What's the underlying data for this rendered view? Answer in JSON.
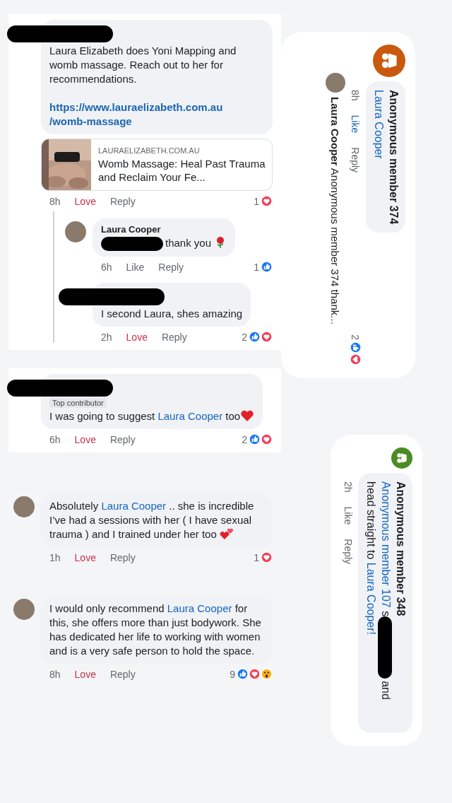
{
  "left_panels": [
    {
      "comments": [
        {
          "name_redacted": true,
          "segments": [
            {
              "kind": "plain",
              "text": "Laura Elizabeth does Yoni Mapping and womb massage. Reach out to her for recommendations."
            }
          ],
          "link_lines": [
            "https://www.lauraelizabeth.com.au",
            "/womb-massage"
          ],
          "preview": {
            "domain": "LAURAELIZABETH.COM.AU",
            "title": "Womb Massage: Heal Past Trauma and Reclaim Your Fe..."
          },
          "time": "8h",
          "action": {
            "label": "Love",
            "kind": "love",
            "reacted": true
          },
          "reply_label": "Reply",
          "reaction_count": "1",
          "reaction_icons": [
            {
              "kind": "love"
            }
          ],
          "replies": [
            {
              "author": "Laura Cooper",
              "segments": [
                {
                  "kind": "redaction"
                },
                {
                  "kind": "plain",
                  "text": "thank you"
                },
                {
                  "kind": "rose"
                }
              ],
              "time": "6h",
              "action": {
                "label": "Like",
                "reacted": false
              },
              "reply_label": "Reply",
              "reaction_count": "1",
              "reaction_icons": [
                {
                  "kind": "like"
                }
              ]
            },
            {
              "name_redacted": true,
              "segments": [
                {
                  "kind": "plain",
                  "text": "I second Laura, shes amazing"
                }
              ],
              "time": "2h",
              "action": {
                "label": "Love",
                "kind": "love",
                "reacted": true
              },
              "reply_label": "Reply",
              "reaction_count": "2",
              "reaction_icons": [
                {
                  "kind": "like"
                },
                {
                  "kind": "love"
                }
              ]
            }
          ]
        }
      ]
    },
    {
      "comments": [
        {
          "name_redacted": true,
          "badge": "Top contributor",
          "segments": [
            {
              "kind": "plain",
              "text": "I was going to suggest "
            },
            {
              "kind": "mention",
              "text": "Laura Cooper"
            },
            {
              "kind": "plain",
              "text": " too"
            },
            {
              "kind": "heart"
            }
          ],
          "time": "6h",
          "action": {
            "label": "Love",
            "kind": "love",
            "reacted": true
          },
          "reply_label": "Reply",
          "reaction_count": "2",
          "reaction_icons": [
            {
              "kind": "like"
            },
            {
              "kind": "love"
            }
          ]
        }
      ]
    },
    {
      "comments": [
        {
          "segments": [
            {
              "kind": "plain",
              "text": "Absolutely "
            },
            {
              "kind": "mention",
              "text": "Laura Cooper"
            },
            {
              "kind": "plain",
              "text": " .. she is incredible I’ve had a sessions with her  ( I have sexual trauma ) and I trained under her too"
            },
            {
              "kind": "hearts"
            }
          ],
          "time": "1h",
          "action": {
            "label": "Love",
            "kind": "love",
            "reacted": true
          },
          "reply_label": "Reply",
          "reaction_count": "1",
          "reaction_icons": [
            {
              "kind": "love"
            }
          ]
        },
        {
          "segments": [
            {
              "kind": "plain",
              "text": "I would only recommend "
            },
            {
              "kind": "mention",
              "text": "Laura Cooper"
            },
            {
              "kind": "plain",
              "text": " for this, she offers more than just bodywork. She has dedicated her life to working with women and is a very safe person to hold the space."
            }
          ],
          "time": "8h",
          "action": {
            "label": "Love",
            "kind": "love",
            "reacted": true
          },
          "reply_label": "Reply",
          "reaction_count": "9",
          "reaction_icons": [
            {
              "kind": "like"
            },
            {
              "kind": "love"
            },
            {
              "kind": "wow"
            }
          ]
        }
      ]
    }
  ],
  "rotated_cards": [
    {
      "color": "#c8590f",
      "author": "Anonymous member 374",
      "segments": [
        {
          "kind": "mention",
          "text": "Laura Cooper"
        }
      ],
      "time": "8h",
      "action": {
        "label": "Like",
        "reacted": true
      },
      "reply_label": "Reply",
      "reaction_count": "2",
      "reaction_icons": [
        {
          "kind": "like"
        },
        {
          "kind": "love"
        }
      ],
      "reply_preview": {
        "author": "Laura Cooper",
        "text": "Anonymous member 374 thank..."
      }
    },
    {
      "color": "#4a8c23",
      "author": "Anonymous member 348",
      "segments": [
        {
          "kind": "mention",
          "text": "Anonymous member 107"
        },
        {
          "kind": "plain",
          "text": " s"
        },
        {
          "kind": "redaction"
        },
        {
          "kind": "plain",
          "text": "and head straight to "
        },
        {
          "kind": "mention",
          "text": "Laura Cooper!"
        }
      ],
      "time": "2h",
      "action": {
        "label": "Like",
        "reacted": false
      },
      "reply_label": "Reply"
    }
  ]
}
